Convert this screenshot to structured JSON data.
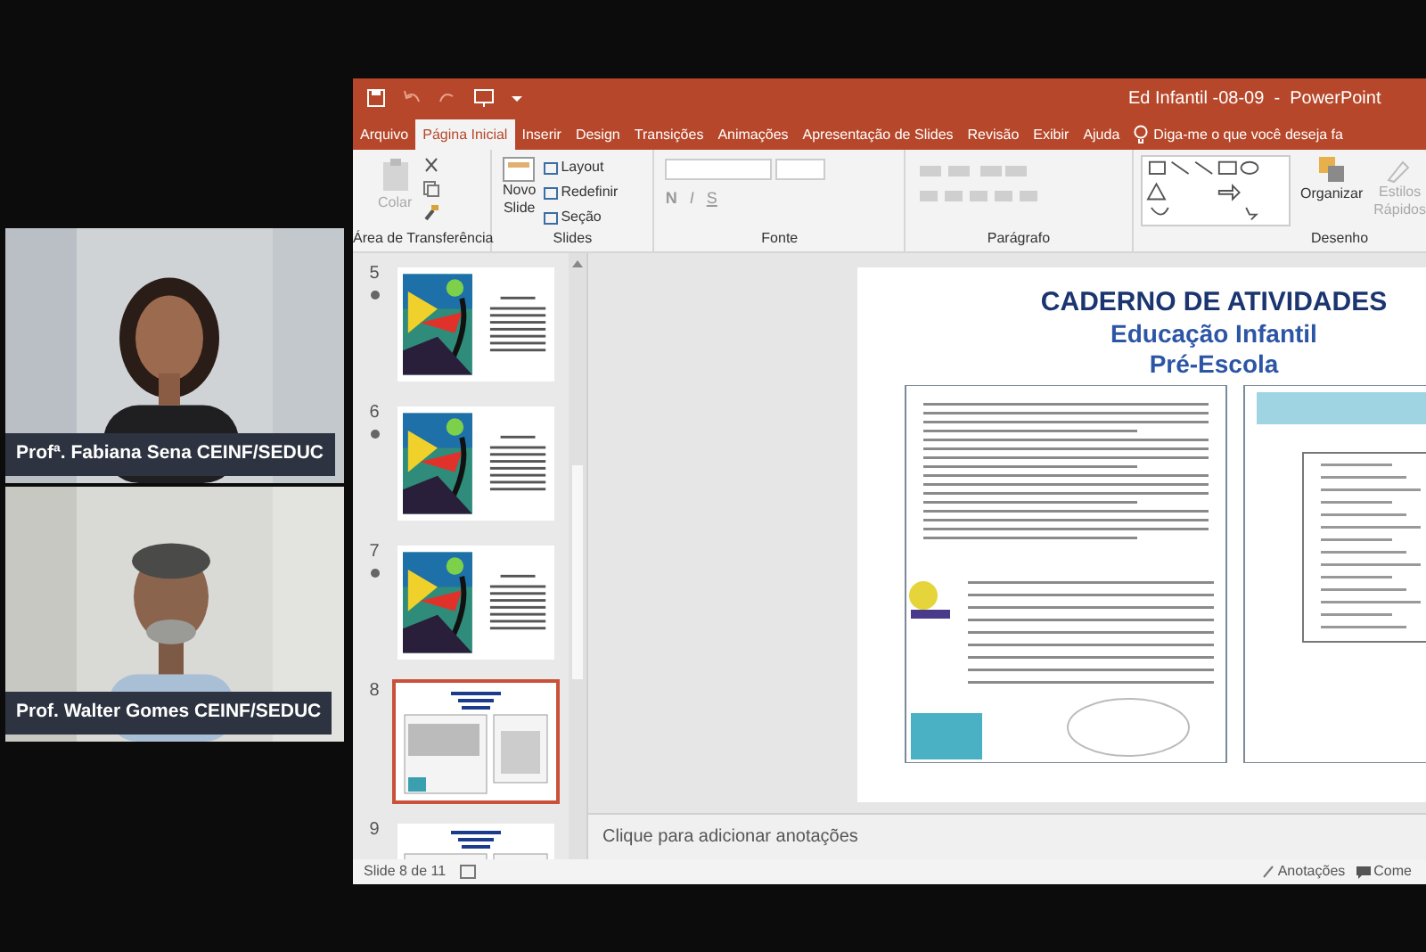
{
  "participants": [
    {
      "name": "Profª. Fabiana Sena CEINF/SEDUC"
    },
    {
      "name": "Prof. Walter Gomes CEINF/SEDUC"
    }
  ],
  "window": {
    "title": "Ed Infantil -08-09  -  PowerPoint"
  },
  "tabs": [
    {
      "label": "Arquivo",
      "selected": false
    },
    {
      "label": "Página Inicial",
      "selected": true
    },
    {
      "label": "Inserir",
      "selected": false
    },
    {
      "label": "Design",
      "selected": false
    },
    {
      "label": "Transições",
      "selected": false
    },
    {
      "label": "Animações",
      "selected": false
    },
    {
      "label": "Apresentação de Slides",
      "selected": false
    },
    {
      "label": "Revisão",
      "selected": false
    },
    {
      "label": "Exibir",
      "selected": false
    },
    {
      "label": "Ajuda",
      "selected": false
    }
  ],
  "tell_me": {
    "placeholder": "Diga-me o que você deseja fa"
  },
  "ribbon": {
    "paste": {
      "label": "Colar",
      "disabled": true
    },
    "new_slide": {
      "label_1": "Novo",
      "label_2": "Slide"
    },
    "slide_buttons": [
      "Layout",
      "Redefinir",
      "Seção"
    ],
    "font_buttons": [
      "N",
      "I",
      "S"
    ],
    "organize": "Organizar",
    "quick_styles": {
      "label_1": "Estilos",
      "label_2": "Rápidos",
      "disabled": true
    },
    "groups": [
      "Área de Transferência",
      "Slides",
      "Fonte",
      "Parágrafo",
      "Desenho"
    ]
  },
  "slides": [
    {
      "number": "5",
      "transition": true,
      "selected": false,
      "kind": "art"
    },
    {
      "number": "6",
      "transition": true,
      "selected": false,
      "kind": "art"
    },
    {
      "number": "7",
      "transition": true,
      "selected": false,
      "kind": "art"
    },
    {
      "number": "8",
      "transition": false,
      "selected": true,
      "kind": "document"
    },
    {
      "number": "9",
      "transition": false,
      "selected": false,
      "kind": "document"
    }
  ],
  "current_slide": {
    "title": "CADERNO DE ATIVIDADES",
    "subtitle_1": "Educação Infantil",
    "subtitle_2": "Pré-Escola"
  },
  "notes": {
    "placeholder": "Clique para adicionar anotações"
  },
  "status_bar": {
    "slide_count": "Slide 8 de 11",
    "notes_button": "Anotações",
    "comments_button": "Come"
  }
}
